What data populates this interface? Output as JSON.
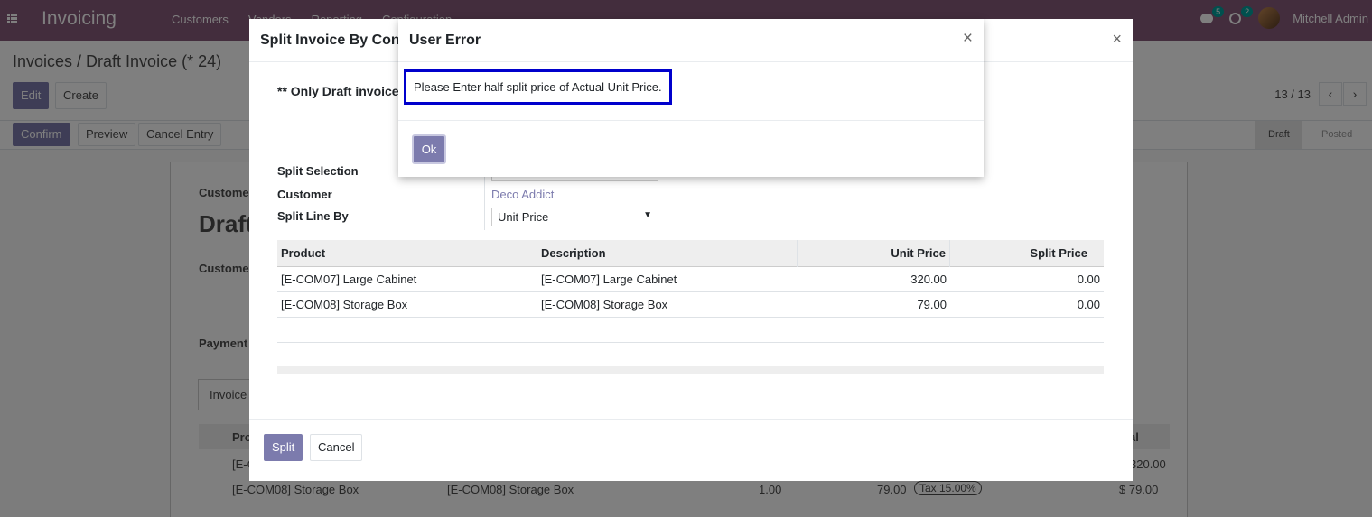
{
  "navbar": {
    "app_title": "Invoicing",
    "menu": [
      "Customers",
      "Vendors",
      "Reporting",
      "Configuration"
    ],
    "messages_count": "5",
    "activities_count": "2",
    "user_name": "Mitchell Admin"
  },
  "control_panel": {
    "breadcrumb": "Invoices / Draft Invoice (* 24)",
    "edit_label": "Edit",
    "create_label": "Create",
    "confirm_label": "Confirm",
    "preview_label": "Preview",
    "cancel_entry_label": "Cancel Entry",
    "pager": "13 / 13",
    "prev_icon": "‹",
    "next_icon": "›",
    "stages": [
      "Draft",
      "Posted"
    ]
  },
  "sheet": {
    "customer_label_1": "Custome",
    "title_fragment": "Draft",
    "customer_label_2": "Custome",
    "payment_label": "Payment",
    "tab_label": "Invoice",
    "col_fragment": "Pro",
    "total_fragment": "al",
    "row1_code_fragment": "[E-C",
    "row1_total_fragment": "320.00",
    "row2_product": "[E-COM08] Storage Box",
    "row2_label": "[E-COM08] Storage Box",
    "row2_qty": "1.00",
    "row2_price": "79.00",
    "row2_tax": "Tax 15.00%",
    "row2_total": "$ 79.00"
  },
  "split_dialog": {
    "title": "Split Invoice By Cond",
    "note": "** Only Draft invoice",
    "close_icon": "×",
    "fields": {
      "split_selection_label": "Split Selection",
      "customer_label": "Customer",
      "customer_value": "Deco Addict",
      "split_line_by_label": "Split Line By",
      "split_line_by_value": "Unit Price"
    },
    "table": {
      "headers": [
        "Product",
        "Description",
        "Unit Price",
        "Split Price"
      ],
      "rows": [
        [
          "[E-COM07] Large Cabinet",
          "[E-COM07] Large Cabinet",
          "320.00",
          "0.00"
        ],
        [
          "[E-COM08] Storage Box",
          "[E-COM08] Storage Box",
          "79.00",
          "0.00"
        ]
      ]
    },
    "split_button": "Split",
    "cancel_button": "Cancel"
  },
  "error_dialog": {
    "title": "User Error",
    "close_icon": "×",
    "message": "Please Enter half split price of Actual Unit Price.",
    "ok_button": "Ok"
  },
  "colors": {
    "brand": "#875A7B",
    "primary": "#7C7BAD",
    "highlight_border": "#0000CC"
  }
}
